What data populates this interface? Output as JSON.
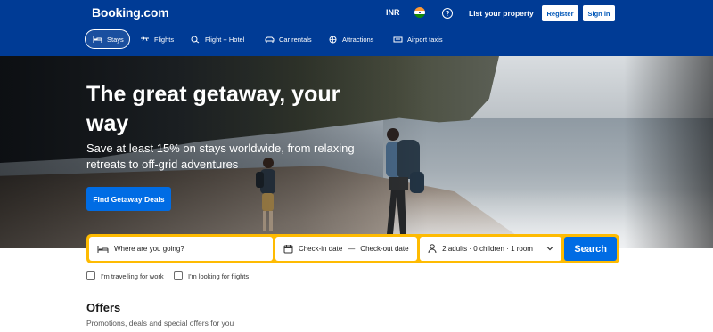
{
  "header": {
    "logo": "Booking.com",
    "currency": "INR",
    "help_symbol": "?",
    "list_property": "List your property",
    "register": "Register",
    "sign_in": "Sign in"
  },
  "nav": {
    "tabs": [
      {
        "label": "Stays",
        "icon": "bed-icon",
        "active": true
      },
      {
        "label": "Flights",
        "icon": "plane-icon"
      },
      {
        "label": "Flight + Hotel",
        "icon": "plane-hotel-icon"
      },
      {
        "label": "Car rentals",
        "icon": "car-icon"
      },
      {
        "label": "Attractions",
        "icon": "attractions-icon"
      },
      {
        "label": "Airport taxis",
        "icon": "taxi-icon"
      }
    ]
  },
  "hero": {
    "title": "The great getaway, your way",
    "subtitle": "Save at least 15% on stays worldwide, from relaxing retreats to off-grid adventures",
    "cta": "Find Getaway Deals"
  },
  "search": {
    "destination_placeholder": "Where are you going?",
    "checkin": "Check-in date",
    "separator": "—",
    "checkout": "Check-out date",
    "guests": "2 adults · 0 children · 1 room",
    "button": "Search"
  },
  "options": {
    "work": "I'm travelling for work",
    "flights": "I'm looking for flights"
  },
  "offers": {
    "title": "Offers",
    "subtitle": "Promotions, deals and special offers for you"
  },
  "colors": {
    "brand": "#003b95",
    "primary": "#006ce4",
    "search_border": "#febb02"
  }
}
